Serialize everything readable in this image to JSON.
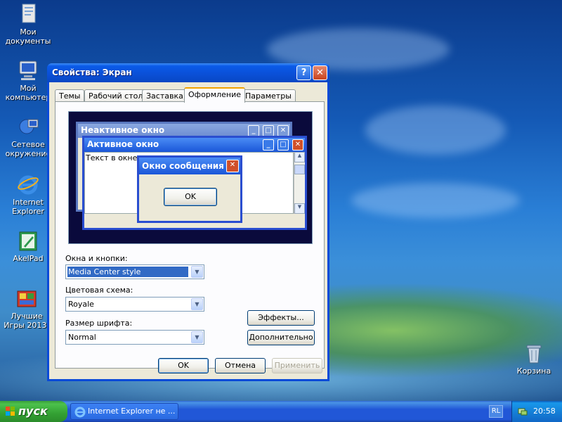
{
  "desktop": {
    "icons": [
      {
        "label": "Мои документы"
      },
      {
        "label": "Мой компьютер"
      },
      {
        "label": "Сетевое окружение"
      },
      {
        "label": "Internet Explorer"
      },
      {
        "label": "AkelPad"
      },
      {
        "label": "Лучшие Игры 2013!"
      },
      {
        "label": "Корзина"
      }
    ]
  },
  "window": {
    "title": "Свойства: Экран",
    "help_glyph": "?",
    "close_glyph": "✕",
    "tabs": [
      {
        "label": "Темы"
      },
      {
        "label": "Рабочий стол"
      },
      {
        "label": "Заставка"
      },
      {
        "label": "Оформление"
      },
      {
        "label": "Параметры"
      }
    ],
    "active_tab": "Оформление",
    "preview": {
      "inactive_title": "Неактивное окно",
      "active_title": "Активное окно",
      "window_text": "Текст в окне",
      "message_title": "Окно сообщения",
      "message_ok": "OK"
    },
    "windows_buttons": {
      "label": "Окна и кнопки:",
      "value": "Media Center style"
    },
    "color_scheme": {
      "label": "Цветовая схема:",
      "value": "Royale"
    },
    "font_size": {
      "label": "Размер шрифта:",
      "value": "Normal"
    },
    "effects_button": "Эффекты...",
    "advanced_button": "Дополнительно",
    "ok_button": "OK",
    "cancel_button": "Отмена",
    "apply_button": "Применить"
  },
  "taskbar": {
    "start_label": "пуск",
    "task_label": "Internet Explorer не ...",
    "lang": "RL",
    "clock": "20:58"
  },
  "colors": {
    "title_blue": "#0a4ad8",
    "close_red": "#c9431e",
    "dialog_bg": "#ece9d8",
    "start_green": "#33a133"
  }
}
